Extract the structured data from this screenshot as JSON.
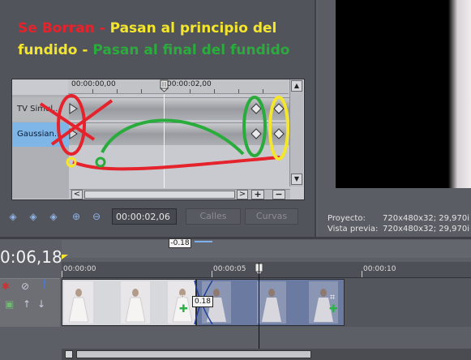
{
  "annotation": {
    "line1_red": "Se Borran - ",
    "line1_yellow": "Pasan al principio del",
    "line2_yellow": "fundido - ",
    "line2_green": "Pasan al final del fundido",
    "colors": {
      "red": "#e5232d",
      "yellow": "#f4e62c",
      "green": "#2aac3c"
    }
  },
  "keyframe_panel": {
    "ruler": {
      "start": "00:00:00,00",
      "mid": "00:00:02,00"
    },
    "tracks": [
      {
        "label": "TV Simul..."
      },
      {
        "label": "Gaussian..."
      }
    ],
    "scroll_up": "▲",
    "scroll_down": "▼",
    "scroll_left": "<",
    "scroll_right": ">",
    "plus_button": "+",
    "minus_button": "−"
  },
  "keyframe_toolbar": {
    "icons": [
      "first-keyframe-icon",
      "prev-keyframe-icon",
      "next-keyframe-icon",
      "add-keyframe-icon",
      "delete-keyframe-icon"
    ],
    "time_value": "00:00:02,06",
    "calles_label": "Calles",
    "curvas_label": "Curvas"
  },
  "preview": {
    "proyecto_label": "Proyecto:",
    "proyecto_value": "720x480x32; 29,970i",
    "vista_label": "Vista previa:",
    "vista_value": "720x480x32; 29,970i"
  },
  "timeline": {
    "current_time": "0:06,18",
    "fade_offset": "-0.18",
    "ruler": [
      "00:00:00",
      "00:00:05",
      "00:00:10"
    ],
    "fade_length": "0.18"
  }
}
